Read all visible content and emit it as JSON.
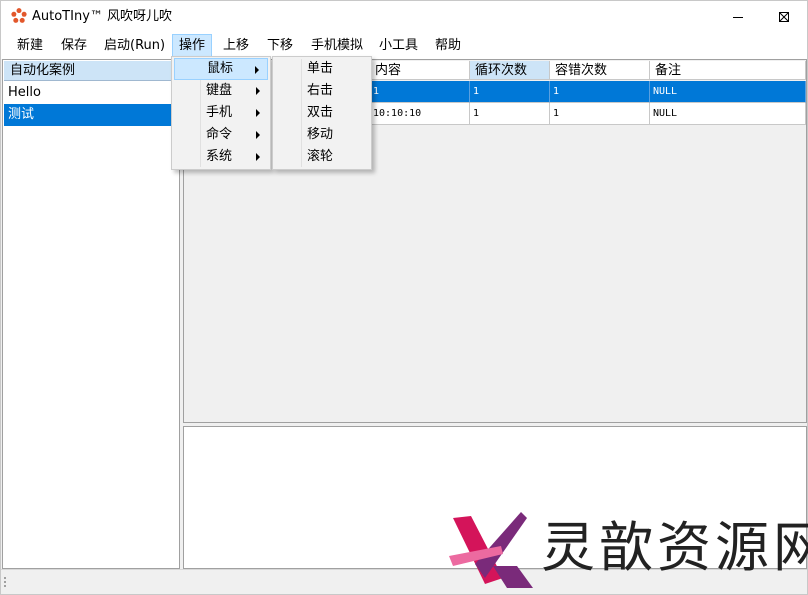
{
  "window": {
    "title": "AutoTIny™ 风吹呀儿吹",
    "controls": [
      "minimize",
      "maximize",
      "close"
    ]
  },
  "menubar": {
    "items": [
      "新建",
      "保存",
      "启动(Run)",
      "操作",
      "上移",
      "下移",
      "手机模拟",
      "小工具",
      "帮助"
    ],
    "active": "操作"
  },
  "operate_menu": {
    "items": [
      "鼠标",
      "键盘",
      "手机",
      "命令",
      "系统"
    ],
    "highlighted": "鼠标"
  },
  "mouse_submenu": {
    "items": [
      "单击",
      "右击",
      "双击",
      "移动",
      "滚轮"
    ]
  },
  "case_list": {
    "header": "自动化案例",
    "items": [
      "Hello",
      "测试"
    ],
    "selected": "测试"
  },
  "grid": {
    "columns": [
      "内容",
      "循环次数",
      "容错次数",
      "备注"
    ],
    "highlighted_column": "循环次数",
    "rows": [
      {
        "content": "1",
        "loops": "1",
        "tolerance": "1",
        "note": "NULL",
        "selected": true
      },
      {
        "content": "10:10:10",
        "loops": "1",
        "tolerance": "1",
        "note": "NULL",
        "selected": false
      }
    ]
  },
  "watermark": {
    "text": "灵歆资源网"
  },
  "colors": {
    "selection": "#0078d7",
    "menu_highlight": "#cce8ff",
    "header_highlight": "#cde4f7",
    "watermark_magenta": "#d4145a",
    "watermark_purple": "#7a2a7a"
  }
}
